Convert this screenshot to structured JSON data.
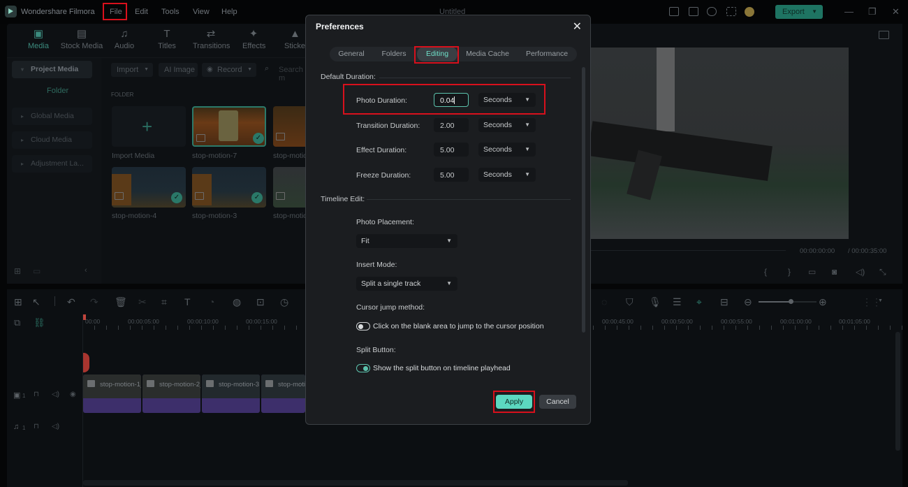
{
  "app": {
    "name": "Wondershare Filmora",
    "document_title": "Untitled",
    "menu": [
      "File",
      "Edit",
      "Tools",
      "View",
      "Help"
    ],
    "export_label": "Export",
    "highlighted_menu": "File"
  },
  "nav_tabs": [
    {
      "label": "Media",
      "icon": "media-icon",
      "active": true
    },
    {
      "label": "Stock Media",
      "icon": "stock-media-icon"
    },
    {
      "label": "Audio",
      "icon": "music-note-icon"
    },
    {
      "label": "Titles",
      "icon": "titles-icon"
    },
    {
      "label": "Transitions",
      "icon": "transitions-icon"
    },
    {
      "label": "Effects",
      "icon": "effects-icon"
    },
    {
      "label": "Sticker",
      "icon": "sticker-icon"
    }
  ],
  "sidebar": {
    "project_media": "Project Media",
    "folder": "Folder",
    "items": [
      "Global Media",
      "Cloud Media",
      "Adjustment La..."
    ]
  },
  "media_toolbar": {
    "import": "Import",
    "ai_image": "AI Image",
    "record": "Record",
    "search_placeholder": "Search m"
  },
  "media": {
    "section_label": "FOLDER",
    "import_label": "Import Media",
    "items": [
      {
        "name": "stop-motion-7",
        "selected": true,
        "used": true
      },
      {
        "name": "stop-motio",
        "used": false
      },
      {
        "name": "stop-motion-4",
        "used": true
      },
      {
        "name": "stop-motion-3",
        "used": true
      },
      {
        "name": "stop-motio",
        "used": false
      }
    ]
  },
  "preview": {
    "current_time": "00:00:00:00",
    "total_time": "/ 00:00:35:00"
  },
  "timeline": {
    "ruler_left": [
      "00:00",
      "00:00:05:00",
      "00:00:10:00",
      "00:00:15:00"
    ],
    "ruler_right": [
      "00:00:45:00",
      "00:00:50:00",
      "00:00:55:00",
      "00:01:00:00",
      "00:01:05:00"
    ],
    "clips": [
      "stop-motion-1_",
      "stop-motion-2_",
      "stop-motion-3",
      "stop-motio"
    ],
    "video_track_num": "1",
    "audio_track_num": "1",
    "zoom_level": 0.55
  },
  "dialog": {
    "title": "Preferences",
    "tabs": [
      "General",
      "Folders",
      "Editing",
      "Media Cache",
      "Performance"
    ],
    "active_tab": "Editing",
    "default_duration_header": "Default Duration:",
    "durations": [
      {
        "label": "Photo Duration:",
        "value": "0.04",
        "unit": "Seconds",
        "focused": true
      },
      {
        "label": "Transition Duration:",
        "value": "2.00",
        "unit": "Seconds"
      },
      {
        "label": "Effect Duration:",
        "value": "5.00",
        "unit": "Seconds"
      },
      {
        "label": "Freeze Duration:",
        "value": "5.00",
        "unit": "Seconds"
      }
    ],
    "timeline_edit_header": "Timeline Edit:",
    "photo_placement_label": "Photo Placement:",
    "photo_placement_value": "Fit",
    "insert_mode_label": "Insert Mode:",
    "insert_mode_value": "Split a single track",
    "cursor_jump_label": "Cursor jump method:",
    "cursor_jump_option": "Click on the blank area to jump to the cursor position",
    "cursor_jump_enabled": false,
    "split_button_label": "Split Button:",
    "split_button_option": "Show the split button on timeline playhead",
    "split_button_enabled": true,
    "apply_label": "Apply",
    "cancel_label": "Cancel"
  },
  "colors": {
    "accent": "#5cd8c0",
    "highlight_box": "#d8101c",
    "clip_purple": "#3d2f6b"
  }
}
